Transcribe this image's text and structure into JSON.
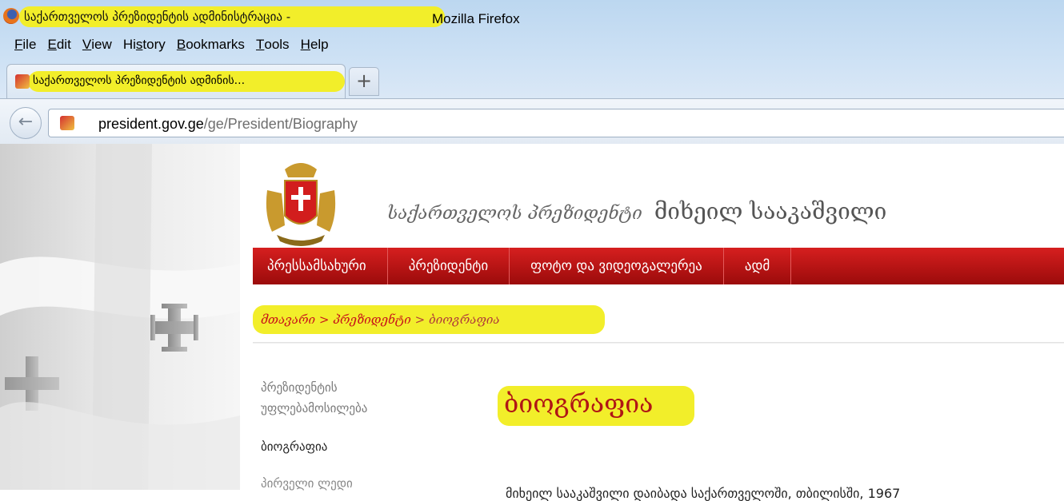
{
  "browser": {
    "window_title": "საქართველოს პრეზიდენტის ადმინისტრაცია",
    "title_separator": "-",
    "app_name": "Mozilla Firefox",
    "menu": [
      "File",
      "Edit",
      "View",
      "History",
      "Bookmarks",
      "Tools",
      "Help"
    ],
    "menu_access_keys": [
      "F",
      "E",
      "V",
      "s",
      "B",
      "T",
      "H"
    ],
    "tab_title": "საქართველოს პრეზიდენტის ადმინის...",
    "new_tab_label": "+",
    "url_host": "president.gov.ge",
    "url_path": "/ge/President/Biography",
    "back_icon": "back-arrow-icon",
    "highlight_color": "#f2ee2a"
  },
  "site": {
    "title_italic": "საქართველოს პრეზიდენტი",
    "title_name": "მიხეილ სააკაშვილი",
    "nav": [
      "პრესსამსახური",
      "პრეზიდენტი",
      "ფოტო და ვიდეოგალერეა",
      "ადმ"
    ],
    "nav_color": "#c31414",
    "breadcrumb": {
      "items": [
        "მთავარი",
        "პრეზიდენტი"
      ],
      "separator": ">",
      "current": "ბიოგრაფია"
    },
    "sidebar": {
      "item1_line1": "პრეზიდენტის",
      "item1_line2": "უფლებამოსილება",
      "item2": "ბიოგრაფია",
      "item3": "პირველი ლედი"
    },
    "page_heading": "ბიოგრაფია",
    "body_first_line": "მიხეილ სააკაშვილი დაიბადა საქართველოში, თბილისში, 1967"
  }
}
